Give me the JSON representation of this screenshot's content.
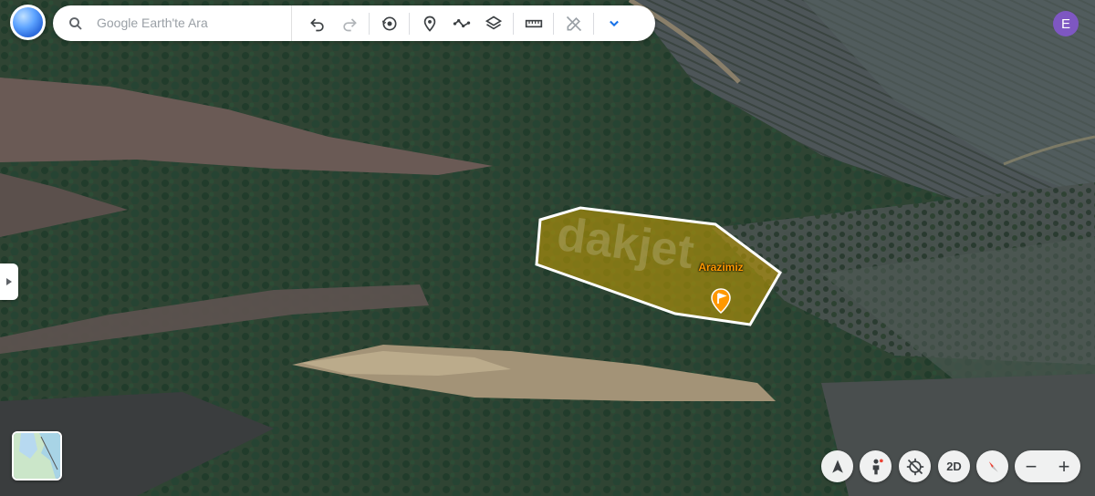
{
  "search": {
    "placeholder": "Google Earth'te Ara"
  },
  "toolbar": {
    "icons": [
      "undo-icon",
      "redo-icon",
      "historical-imagery-icon",
      "add-placemark-icon",
      "draw-path-icon",
      "layers-icon",
      "measure-icon",
      "edit-tools-icon",
      "expand-chevron-icon"
    ]
  },
  "user": {
    "avatar_letter": "E",
    "avatar_color": "#7e57c2"
  },
  "placemark": {
    "label": "Arazimiz",
    "color": "#ff9800",
    "polygon_fill": "#c9a000",
    "polygon_stroke": "#ffffff"
  },
  "watermark": {
    "text": "dakjet"
  },
  "controls": {
    "mode_label": "2D",
    "zoom_out": "−",
    "zoom_in": "+"
  }
}
